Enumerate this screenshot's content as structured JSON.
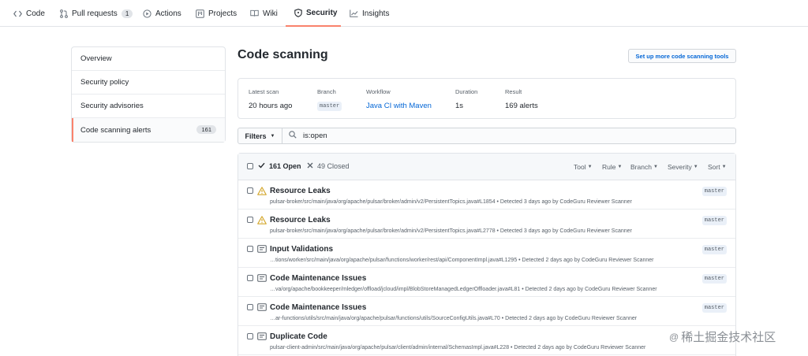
{
  "repo_nav": {
    "items": [
      {
        "label": "Code",
        "icon": "code-icon"
      },
      {
        "label": "Pull requests",
        "icon": "pull-request-icon",
        "count": "1"
      },
      {
        "label": "Actions",
        "icon": "play-icon"
      },
      {
        "label": "Projects",
        "icon": "project-icon"
      },
      {
        "label": "Wiki",
        "icon": "book-icon"
      },
      {
        "label": "Security",
        "icon": "shield-icon"
      },
      {
        "label": "Insights",
        "icon": "graph-icon"
      }
    ],
    "selected": "Security"
  },
  "sidebar": {
    "items": [
      {
        "label": "Overview"
      },
      {
        "label": "Security policy"
      },
      {
        "label": "Security advisories"
      },
      {
        "label": "Code scanning alerts",
        "count": "161"
      }
    ],
    "active": "Code scanning alerts"
  },
  "page": {
    "title": "Code scanning",
    "setup_button": "Set up more code scanning tools"
  },
  "summary": {
    "latest_scan_label": "Latest scan",
    "latest_scan_value": "20 hours ago",
    "branch_label": "Branch",
    "branch_value": "master",
    "workflow_label": "Workflow",
    "workflow_value": "Java CI with Maven",
    "duration_label": "Duration",
    "duration_value": "1s",
    "result_label": "Result",
    "result_value": "169 alerts"
  },
  "filter_bar": {
    "filters_label": "Filters",
    "search_value": "is:open"
  },
  "list_header": {
    "open_label": "161 Open",
    "closed_label": "49 Closed",
    "filters": [
      "Tool",
      "Rule",
      "Branch",
      "Severity",
      "Sort"
    ]
  },
  "alerts": [
    {
      "title": "Resource Leaks",
      "severity": "warning",
      "meta": "pulsar-broker/src/main/java/org/apache/pulsar/broker/admin/v2/PersistentTopics.java#L1854 • Detected 3 days ago by CodeGuru Reviewer Scanner",
      "branch": "master"
    },
    {
      "title": "Resource Leaks",
      "severity": "warning",
      "meta": "pulsar-broker/src/main/java/org/apache/pulsar/broker/admin/v2/PersistentTopics.java#L2778 • Detected 3 days ago by CodeGuru Reviewer Scanner",
      "branch": "master"
    },
    {
      "title": "Input Validations",
      "severity": "note",
      "meta": "…tions/worker/src/main/java/org/apache/pulsar/functions/worker/rest/api/ComponentImpl.java#L1295 • Detected 2 days ago by CodeGuru Reviewer Scanner",
      "branch": "master"
    },
    {
      "title": "Code Maintenance Issues",
      "severity": "note",
      "meta": "…va/org/apache/bookkeeper/mledger/offload/jcloud/impl/BlobStoreManagedLedgerOffloader.java#L81 • Detected 2 days ago by CodeGuru Reviewer Scanner",
      "branch": "master"
    },
    {
      "title": "Code Maintenance Issues",
      "severity": "note",
      "meta": "…ar-functions/utils/src/main/java/org/apache/pulsar/functions/utils/SourceConfigUtils.java#L70 • Detected 2 days ago by CodeGuru Reviewer Scanner",
      "branch": "master"
    },
    {
      "title": "Duplicate Code",
      "severity": "note",
      "meta": "pulsar-client-admin/src/main/java/org/apache/pulsar/client/admin/internal/SchemasImpl.java#L228 • Detected 2 days ago by CodeGuru Reviewer Scanner",
      "branch": "master"
    }
  ],
  "watermark": {
    "text": "稀土掘金技术社区"
  },
  "colors": {
    "accent": "#f9826c",
    "link": "#0366d6",
    "warning": "#d4a72c",
    "text": "#24292f",
    "muted": "#586069"
  }
}
